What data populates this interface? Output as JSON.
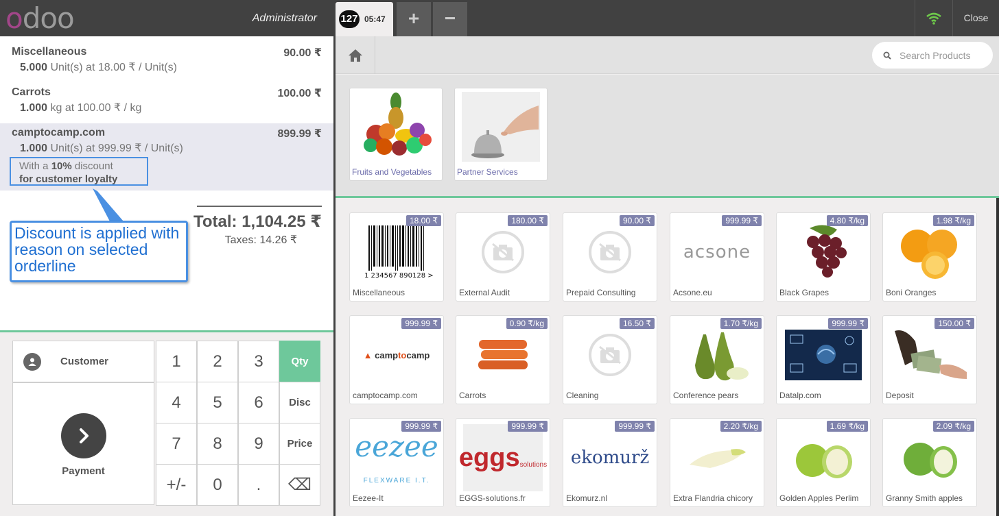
{
  "header": {
    "logo_first": "o",
    "logo_rest": "doo",
    "user": "Administrator",
    "order_number": "127",
    "order_time": "05:47",
    "add_label": "+",
    "remove_label": "−",
    "close_label": "Close"
  },
  "orderlines": [
    {
      "name": "Miscellaneous",
      "price": "90.00 ₹",
      "qty": "5.000",
      "info": " Unit(s) at 18.00 ₹ / Unit(s)"
    },
    {
      "name": "Carrots",
      "price": "100.00 ₹",
      "qty": "1.000",
      "info": " kg at 100.00 ₹ / kg"
    },
    {
      "name": "camptocamp.com",
      "price": "899.99 ₹",
      "qty": "1.000",
      "info": " Unit(s) at 999.99 ₹ / Unit(s)"
    }
  ],
  "discount": {
    "prefix": "With a ",
    "percent": "10%",
    "suffix": " discount",
    "reason": "for customer loyalty"
  },
  "totals": {
    "total": "Total: 1,104.25 ₹",
    "taxes": "Taxes: 14.26 ₹"
  },
  "callout": {
    "text": "Discount is applied with reason on selected orderline"
  },
  "numpad": {
    "customer_label": "Customer",
    "payment_label": "Payment",
    "keys": [
      "1",
      "2",
      "3",
      "4",
      "5",
      "6",
      "7",
      "8",
      "9",
      "+/-",
      "0",
      "."
    ],
    "modes": [
      "Qty",
      "Disc",
      "Price"
    ],
    "active_mode": "Qty",
    "backspace": "⌫"
  },
  "search": {
    "placeholder": "Search Products"
  },
  "categories": [
    {
      "name": "Fruits and Vegetables"
    },
    {
      "name": "Partner Services"
    }
  ],
  "products": [
    {
      "name": "Miscellaneous",
      "price": "18.00 ₹"
    },
    {
      "name": "External Audit",
      "price": "180.00 ₹"
    },
    {
      "name": "Prepaid Consulting",
      "price": "90.00 ₹"
    },
    {
      "name": "Acsone.eu",
      "price": "999.99 ₹"
    },
    {
      "name": "Black Grapes",
      "price": "4.80 ₹/kg"
    },
    {
      "name": "Boni Oranges",
      "price": "1.98 ₹/kg"
    },
    {
      "name": "camptocamp.com",
      "price": "999.99 ₹"
    },
    {
      "name": "Carrots",
      "price": "0.90 ₹/kg"
    },
    {
      "name": "Cleaning",
      "price": "16.50 ₹"
    },
    {
      "name": "Conference pears",
      "price": "1.70 ₹/kg"
    },
    {
      "name": "Datalp.com",
      "price": "999.99 ₹"
    },
    {
      "name": "Deposit",
      "price": "150.00 ₹"
    },
    {
      "name": "Eezee-It",
      "price": "999.99 ₹"
    },
    {
      "name": "EGGS-solutions.fr",
      "price": "999.99 ₹"
    },
    {
      "name": "Ekomurz.nl",
      "price": "999.99 ₹"
    },
    {
      "name": "Extra Flandria chicory",
      "price": "2.20 ₹/kg"
    },
    {
      "name": "Golden Apples Perlim",
      "price": "1.69 ₹/kg"
    },
    {
      "name": "Granny Smith apples",
      "price": "2.09 ₹/kg"
    }
  ],
  "logos": {
    "barcode_text": "1 234567 890128 >",
    "acsone": "acsone",
    "camptocamp_a": "camp",
    "camptocamp_b": "to",
    "camptocamp_c": "camp",
    "eezee": "eezee",
    "eezee_sub": "FLEXWARE I.T.",
    "eggs": "eggs",
    "eggs_sub": "solutions",
    "ekomurz": "ekomurž"
  }
}
